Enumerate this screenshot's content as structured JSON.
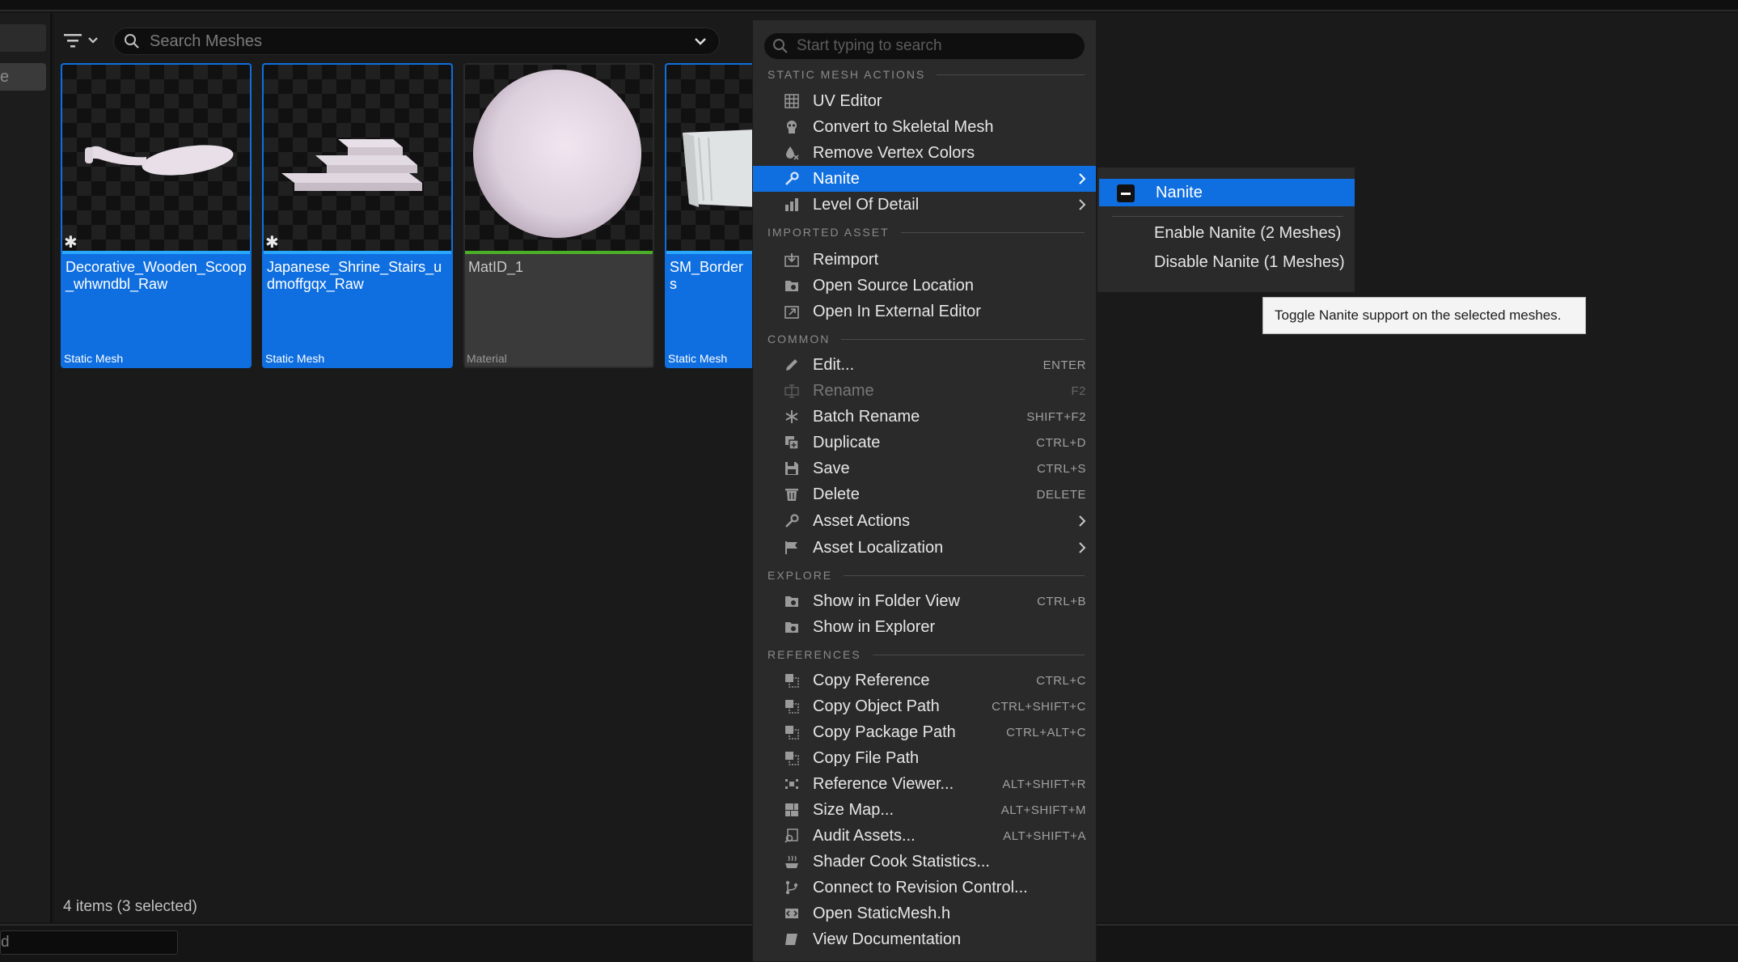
{
  "browser": {
    "search_placeholder": "Search Meshes",
    "status": "4 items (3 selected)",
    "bottom_field": "d",
    "sidebar_chip_text": "e"
  },
  "assets": [
    {
      "name": "Decorative_Wooden_Scoop_whwndbl_Raw",
      "type": "Static Mesh",
      "selected": true
    },
    {
      "name": "Japanese_Shrine_Stairs_udmoffgqx_Raw",
      "type": "Static Mesh",
      "selected": true
    },
    {
      "name": "MatID_1",
      "type": "Material",
      "selected": false
    },
    {
      "name": "SM_Borders",
      "type": "Static Mesh",
      "selected": true
    }
  ],
  "menu": {
    "search_placeholder": "Start typing to search",
    "sections": {
      "static_mesh_actions": "STATIC MESH ACTIONS",
      "imported_asset": "IMPORTED ASSET",
      "common": "COMMON",
      "explore": "EXPLORE",
      "references": "REFERENCES"
    },
    "items": {
      "uv_editor": "UV Editor",
      "convert_skeletal": "Convert to Skeletal Mesh",
      "remove_vertex_colors": "Remove Vertex Colors",
      "nanite": "Nanite",
      "level_of_detail": "Level Of Detail",
      "reimport": "Reimport",
      "open_source_location": "Open Source Location",
      "open_external_editor": "Open In External Editor",
      "edit": "Edit...",
      "rename": "Rename",
      "batch_rename": "Batch Rename",
      "duplicate": "Duplicate",
      "save": "Save",
      "delete": "Delete",
      "asset_actions": "Asset Actions",
      "asset_localization": "Asset Localization",
      "show_folder_view": "Show in Folder View",
      "show_explorer": "Show in Explorer",
      "copy_reference": "Copy Reference",
      "copy_object_path": "Copy Object Path",
      "copy_package_path": "Copy Package Path",
      "copy_file_path": "Copy File Path",
      "reference_viewer": "Reference Viewer...",
      "size_map": "Size Map...",
      "audit_assets": "Audit Assets...",
      "shader_cook": "Shader Cook Statistics...",
      "connect_revision": "Connect to Revision Control...",
      "open_header": "Open StaticMesh.h",
      "view_docs": "View Documentation"
    },
    "shortcuts": {
      "edit": "ENTER",
      "rename": "F2",
      "batch_rename": "SHIFT+F2",
      "duplicate": "CTRL+D",
      "save": "CTRL+S",
      "delete": "DELETE",
      "show_folder_view": "CTRL+B",
      "copy_reference": "CTRL+C",
      "copy_object_path": "CTRL+SHIFT+C",
      "copy_package_path": "CTRL+ALT+C",
      "reference_viewer": "ALT+SHIFT+R",
      "size_map": "ALT+SHIFT+M",
      "audit_assets": "ALT+SHIFT+A"
    }
  },
  "submenu": {
    "header": "Nanite",
    "enable": "Enable Nanite (2 Meshes)",
    "disable": "Disable Nanite (1 Meshes)"
  },
  "tooltip": "Toggle Nanite support on the selected meshes.",
  "colors": {
    "accent": "#0f6fe0",
    "selected_line": "#29a8ff",
    "material_line": "#4caf2a",
    "menu_bg": "#2a2a2a"
  }
}
